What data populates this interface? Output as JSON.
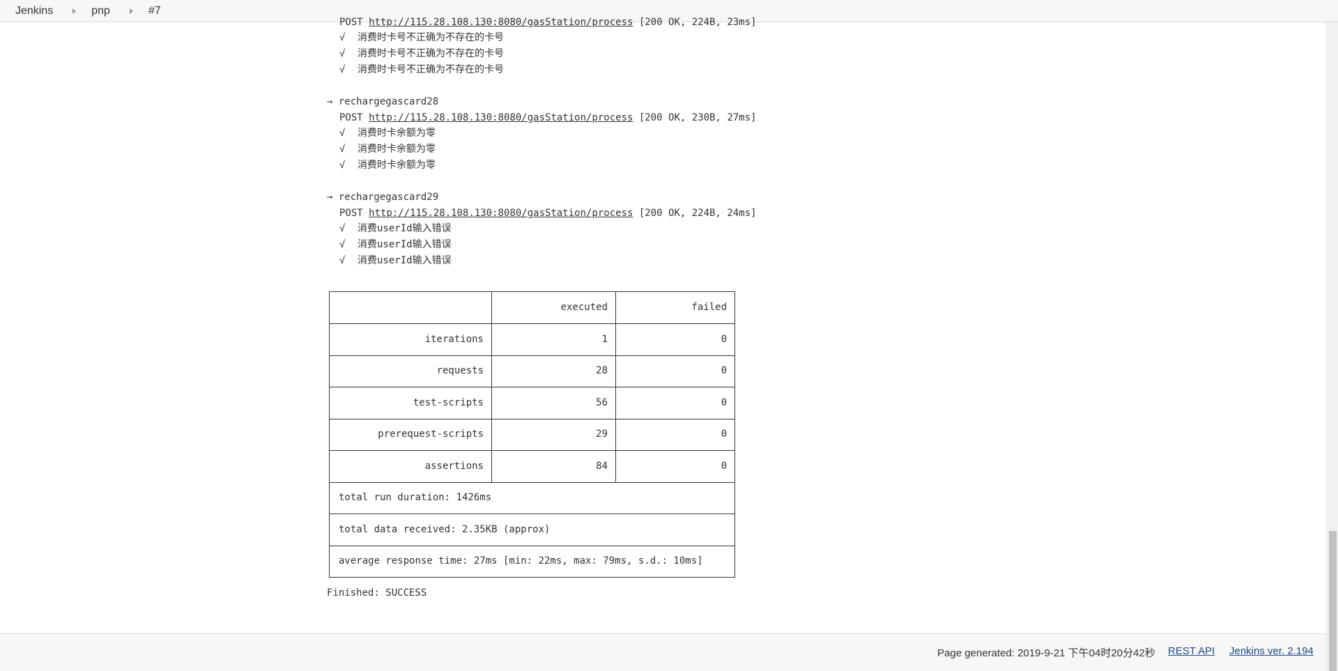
{
  "breadcrumb": {
    "items": [
      "Jenkins",
      "pnp",
      "#7"
    ]
  },
  "console": {
    "partial_line_prefix": "POST ",
    "partial_url": "http://115.28.108.130:8080/gasStation/process",
    "partial_status": " [200 OK, 224B, 23ms]",
    "blocks": [
      {
        "name": "",
        "checks": [
          "消费时卡号不正确为不存在的卡号",
          "消费时卡号不正确为不存在的卡号",
          "消费时卡号不正确为不存在的卡号"
        ]
      },
      {
        "name": "→ rechargegascard28",
        "method": "POST ",
        "url": "http://115.28.108.130:8080/gasStation/process",
        "status": " [200 OK, 230B, 27ms]",
        "checks": [
          "消费时卡余额为零",
          "消费时卡余额为零",
          "消费时卡余额为零"
        ]
      },
      {
        "name": "→ rechargegascard29",
        "method": "POST ",
        "url": "http://115.28.108.130:8080/gasStation/process",
        "status": " [200 OK, 224B, 24ms]",
        "checks": [
          "消费userId输入错误",
          "消费userId输入错误",
          "消费userId输入错误"
        ]
      }
    ],
    "check_mark": "√"
  },
  "summary": {
    "headers": [
      "",
      "executed",
      "failed"
    ],
    "rows": [
      {
        "label": "iterations",
        "executed": "1",
        "failed": "0"
      },
      {
        "label": "requests",
        "executed": "28",
        "failed": "0"
      },
      {
        "label": "test-scripts",
        "executed": "56",
        "failed": "0"
      },
      {
        "label": "prerequest-scripts",
        "executed": "29",
        "failed": "0"
      },
      {
        "label": "assertions",
        "executed": "84",
        "failed": "0"
      }
    ],
    "totals": [
      "total run duration: 1426ms",
      "total data received: 2.35KB (approx)",
      "average response time: 27ms [min: 22ms, max: 79ms, s.d.: 10ms]"
    ],
    "finished": "Finished: SUCCESS"
  },
  "footer": {
    "page_generated": "Page generated: 2019-9-21 下午04时20分42秒",
    "rest_api": "REST API",
    "version": "Jenkins ver. 2.194"
  },
  "colors": {
    "link_footer": "#204a87",
    "bar_bg": "#f7f7f7"
  }
}
